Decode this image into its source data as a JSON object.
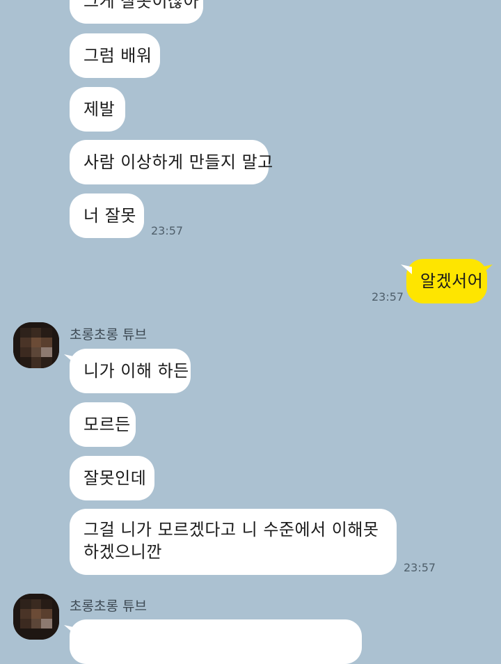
{
  "theme": {
    "background": "#abc1d1",
    "incoming_bubble": "#ffffff",
    "outgoing_bubble": "#fee500"
  },
  "messages": [
    {
      "text": "그게 잘못이잖아"
    },
    {
      "text": "그럼 배워"
    },
    {
      "text": "제발"
    },
    {
      "text": "사람 이상하게 만들지 말고"
    },
    {
      "text": "너 잘못",
      "time": "23:57"
    },
    {
      "text": "알겠서어",
      "time": "23:57"
    },
    {
      "sender": "초롱초롱 튜브",
      "text": "니가 이해 하든"
    },
    {
      "text": "모르든"
    },
    {
      "text": "잘못인데"
    },
    {
      "text": "그걸 니가 모르겠다고 니 수준에서 이해못하겠으니깐",
      "time": "23:57"
    },
    {
      "sender": "초롱초롱 튜브"
    }
  ],
  "icons": {
    "avatar": "pixelated-profile-avatar"
  }
}
